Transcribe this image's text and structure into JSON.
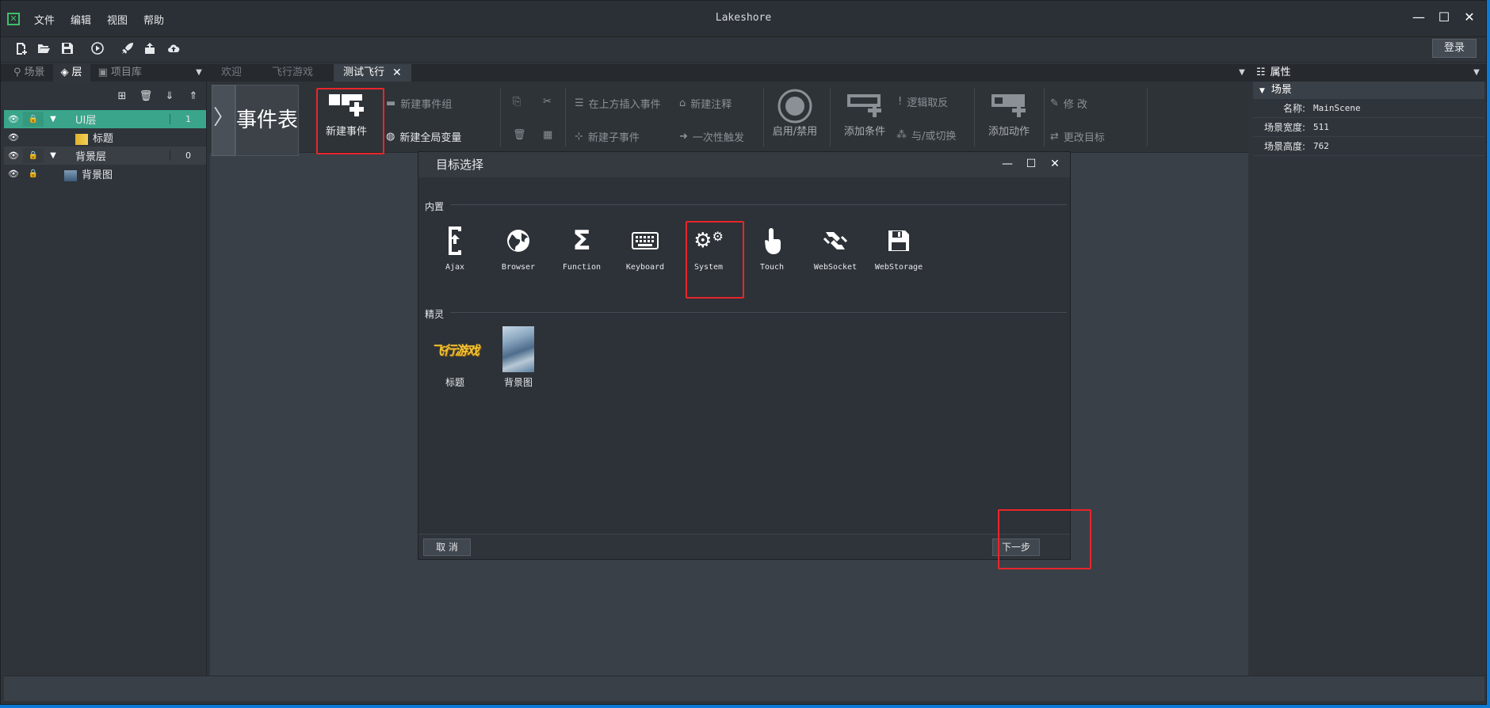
{
  "window": {
    "title": "Lakeshore"
  },
  "menu": [
    "文件",
    "编辑",
    "视图",
    "帮助"
  ],
  "toolbar": {
    "login_label": "登录"
  },
  "left_tabs": [
    "场景",
    "层",
    "项目库"
  ],
  "center_tabs": [
    "欢迎",
    "飞行游戏",
    "测试飞行"
  ],
  "right_tab": "属性",
  "layers": [
    {
      "name": "UI层",
      "count": "1"
    },
    {
      "name": "标题"
    },
    {
      "name": "背景层",
      "count": "0"
    },
    {
      "name": "背景图"
    }
  ],
  "ribbon": {
    "title": "事件表",
    "new_event": "新建事件",
    "new_event_group": "新建事件组",
    "new_global_var": "新建全局变量",
    "insert_above": "在上方插入事件",
    "new_sub_event": "新建子事件",
    "new_comment": "新建注释",
    "trigger_once": "一次性触发",
    "enable_disable": "启用/禁用",
    "add_condition": "添加条件",
    "logic_invert": "逻辑取反",
    "and_or_switch": "与/或切换",
    "add_action": "添加动作",
    "modify": "修  改",
    "change_target": "更改目标"
  },
  "properties": {
    "section": "场景",
    "rows": [
      {
        "key": "名称:",
        "value": "MainScene"
      },
      {
        "key": "场景宽度:",
        "value": "511"
      },
      {
        "key": "场景高度:",
        "value": "762"
      }
    ]
  },
  "dialog": {
    "title": "目标选择",
    "builtin_label": "内置",
    "sprite_label": "精灵",
    "plugins": [
      "Ajax",
      "Browser",
      "Function",
      "Keyboard",
      "System",
      "Touch",
      "WebSocket",
      "WebStorage"
    ],
    "sprites": [
      {
        "name": "标题",
        "logo_text": "飞行游戏"
      },
      {
        "name": "背景图"
      }
    ],
    "cancel": "取  消",
    "next": "下一步"
  },
  "colors": {
    "selected_layer": "#3aa58a",
    "highlight": "#e8262b",
    "taskbar": "#0a7ad6"
  }
}
